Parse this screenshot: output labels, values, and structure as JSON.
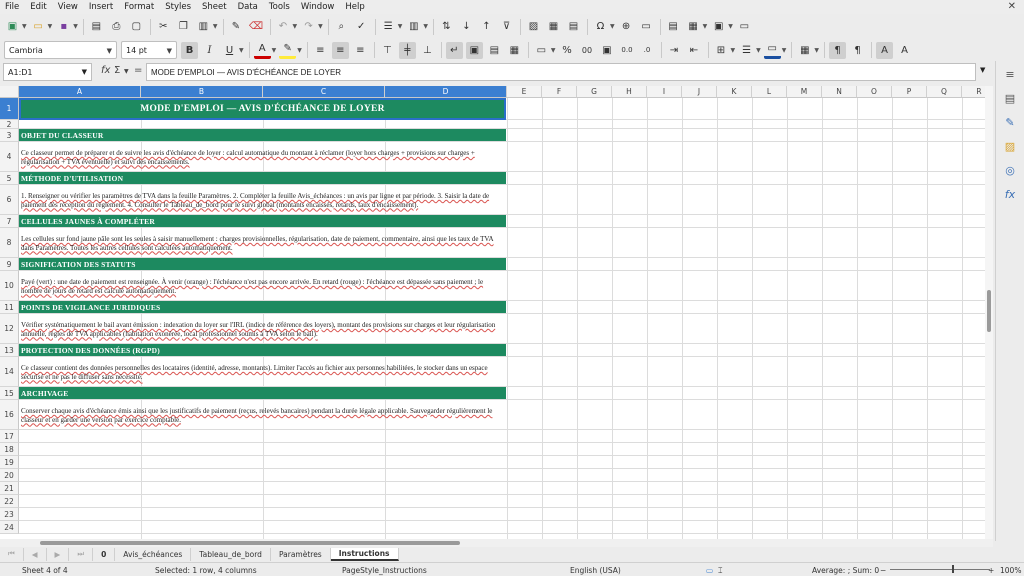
{
  "menu": [
    "File",
    "Edit",
    "View",
    "Insert",
    "Format",
    "Styles",
    "Sheet",
    "Data",
    "Tools",
    "Window",
    "Help"
  ],
  "toolbar": {
    "font_name": "Cambria",
    "font_size": "14 pt",
    "bold": "B",
    "italic": "I",
    "underline": "U",
    "percent": "%",
    "decimals": "0.0",
    "number_format": "00"
  },
  "formula_bar": {
    "cell_ref": "A1:D1",
    "fx": "fx",
    "sum": "Σ",
    "equals": "=",
    "content": "MODE D'EMPLOI — AVIS D'ÉCHÉANCE DE LOYER"
  },
  "columns": [
    "A",
    "B",
    "C",
    "D",
    "E",
    "F",
    "G",
    "H",
    "I",
    "J",
    "K",
    "L",
    "M",
    "N",
    "O",
    "P",
    "Q",
    "R"
  ],
  "rows": [
    "1",
    "2",
    "3",
    "4",
    "5",
    "6",
    "7",
    "8",
    "9",
    "10",
    "11",
    "12",
    "13",
    "14",
    "15",
    "16",
    "17",
    "18",
    "19",
    "20",
    "21",
    "22",
    "23",
    "24"
  ],
  "sheet": {
    "title": "MODE D'EMPLOI — AVIS D'ÉCHÉANCE DE LOYER",
    "sections": [
      {
        "heading": "OBJET DU CLASSEUR",
        "text": "Ce classeur permet de préparer et de suivre les avis d'échéance de loyer : calcul automatique du montant à réclamer (loyer hors charges + provisions sur charges + régularisation + TVA éventuelle) et suivi des encaissements."
      },
      {
        "heading": "MÉTHODE D'UTILISATION",
        "text": "1. Renseigner ou vérifier les paramètres de TVA dans la feuille Paramètres. 2. Compléter la feuille Avis_échéances : un avis par ligne et par période. 3. Saisir la date de paiement dès réception du règlement. 4. Consulter le Tableau_de_bord pour le suivi global (montants encaissés, retards, taux d'encaissement)."
      },
      {
        "heading": "CELLULES JAUNES À COMPLÉTER",
        "text": "Les cellules sur fond jaune pâle sont les seules à saisir manuellement : charges provisionnelles, régularisation, date de paiement, commentaire, ainsi que les taux de TVA dans Paramètres. Toutes les autres cellules sont calculées automatiquement."
      },
      {
        "heading": "SIGNIFICATION DES STATUTS",
        "text": "Payé (vert) : une date de paiement est renseignée. À venir (orange) : l'échéance n'est pas encore arrivée. En retard (rouge) : l'échéance est dépassée sans paiement ; le nombre de jours de retard est calculé automatiquement."
      },
      {
        "heading": "POINTS DE VIGILANCE JURIDIQUES",
        "text": "Vérifier systématiquement le bail avant émission : indexation du loyer sur l'IRL (indice de référence des loyers), montant des provisions sur charges et leur régularisation annuelle, règles de TVA applicables (habitation exonérée, local professionnel soumis à TVA selon le bail)."
      },
      {
        "heading": "PROTECTION DES DONNÉES (RGPD)",
        "text": "Ce classeur contient des données personnelles des locataires (identité, adresse, montants). Limiter l'accès au fichier aux personnes habilitées, le stocker dans un espace sécurisé et ne pas le diffuser sans nécessité."
      },
      {
        "heading": "ARCHIVAGE",
        "text": "Conserver chaque avis d'échéance émis ainsi que les justificatifs de paiement (reçus, relevés bancaires) pendant la durée légale applicable. Sauvegarder régulièrement le classeur et en garder une version par exercice comptable."
      }
    ]
  },
  "tabs": [
    "Avis_échéances",
    "Tableau_de_bord",
    "Paramètres",
    "Instructions"
  ],
  "tab_count_badge": "0",
  "status": {
    "sheet": "Sheet 4 of 4",
    "selection": "Selected: 1 row, 4 columns",
    "page_style": "PageStyle_Instructions",
    "language": "English (USA)",
    "summary": "Average: ; Sum: 0",
    "zoom": "100%"
  },
  "colors": {
    "section_bg": "#1d8a60",
    "selection": "#3b7fd1"
  }
}
